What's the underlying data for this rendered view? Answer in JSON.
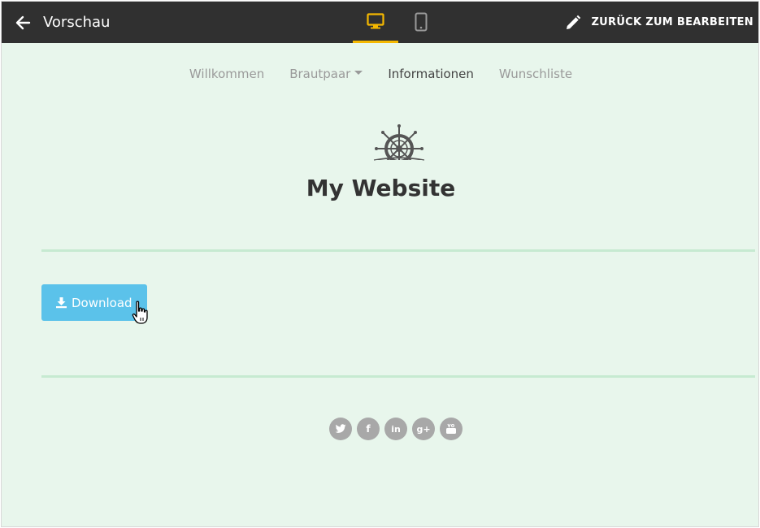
{
  "topbar": {
    "title": "Vorschau",
    "edit_label": "ZURÜCK ZUM BEARBEITEN",
    "accent_color": "#f5b800",
    "icons": [
      "arrow-left-icon",
      "desktop-icon",
      "mobile-icon",
      "pencil-icon"
    ],
    "active_device": "desktop"
  },
  "nav": {
    "items": [
      {
        "label": "Willkommen"
      },
      {
        "label": "Brautpaar"
      },
      {
        "label": "Informationen"
      },
      {
        "label": "Wunschliste"
      }
    ],
    "active_index": 2
  },
  "site": {
    "title": "My Website",
    "logo_icon": "ship-wheel-icon"
  },
  "download": {
    "label": "Download",
    "color": "#5bc2ea"
  },
  "social": {
    "icons": [
      "twitter-icon",
      "facebook-icon",
      "linkedin-icon",
      "google-plus-icon",
      "youtube-icon"
    ],
    "labels": [
      "",
      "f",
      "in",
      "g+",
      ""
    ]
  },
  "colors": {
    "page_bg": "#e8f6ec",
    "divider": "#c6ead1",
    "topbar_bg": "#303030"
  }
}
